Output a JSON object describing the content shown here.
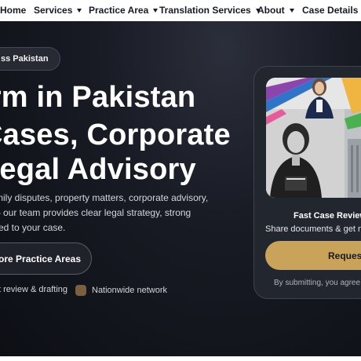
{
  "nav": {
    "items": [
      {
        "label": "Home",
        "dropdown": false
      },
      {
        "label": "Services",
        "dropdown": true
      },
      {
        "label": "Practice Area",
        "dropdown": true
      },
      {
        "label": "Translation Services",
        "dropdown": true
      },
      {
        "label": "About",
        "dropdown": true
      },
      {
        "label": "Case Details",
        "dropdown": false
      }
    ]
  },
  "hero": {
    "badge": "ss Pakistan",
    "headline": [
      "irm in Pakistan",
      "Cases, Corporate",
      "Legal Advisory"
    ],
    "description": [
      "mily disputes, property matters, corporate advisory,",
      "– our team provides clear legal strategy, strong",
      "red to your case."
    ],
    "cta_label": "ore Practice Areas",
    "features": [
      {
        "label": "t review & drafting"
      },
      {
        "label": "Nationwide network"
      }
    ]
  },
  "card": {
    "title": "Fast Case Review",
    "subtitle": "Share documents & get nex",
    "button_label": "Reques",
    "note": "By submitting, you agree to"
  },
  "colors": {
    "hero_bg": "#11131a",
    "accent_gold": "#c9a35a",
    "feature_dot": "#7a6040"
  }
}
